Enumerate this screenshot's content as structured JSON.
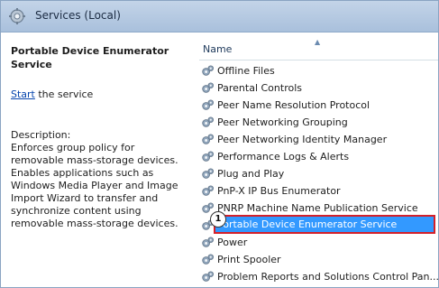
{
  "header": {
    "title": "Services (Local)",
    "icon": "services-gear-icon"
  },
  "description_pane": {
    "service_title": "Portable Device Enumerator Service",
    "start_link": "Start",
    "start_suffix": " the service",
    "description_label": "Description:",
    "description_text": "Enforces group policy for removable mass-storage devices. Enables applications such as Windows Media Player and Image Import Wizard to transfer and synchronize content using removable mass-storage devices."
  },
  "list": {
    "column_name": "Name",
    "sort_indicator": "▲",
    "selected_index": 9,
    "marker_label": "1",
    "rows": [
      {
        "label": "Offline Files"
      },
      {
        "label": "Parental Controls"
      },
      {
        "label": "Peer Name Resolution Protocol"
      },
      {
        "label": "Peer Networking Grouping"
      },
      {
        "label": "Peer Networking Identity Manager"
      },
      {
        "label": "Performance Logs & Alerts"
      },
      {
        "label": "Plug and Play"
      },
      {
        "label": "PnP-X IP Bus Enumerator"
      },
      {
        "label": "PNRP Machine Name Publication Service"
      },
      {
        "label": "Portable Device Enumerator Service"
      },
      {
        "label": "Power"
      },
      {
        "label": "Print Spooler"
      },
      {
        "label": "Problem Reports and Solutions Control Pan..."
      }
    ]
  },
  "colors": {
    "header_bg": "#b7cbe3",
    "selection_bg": "#3399ff",
    "highlight_outline": "#d4202a",
    "link": "#0645ad"
  }
}
